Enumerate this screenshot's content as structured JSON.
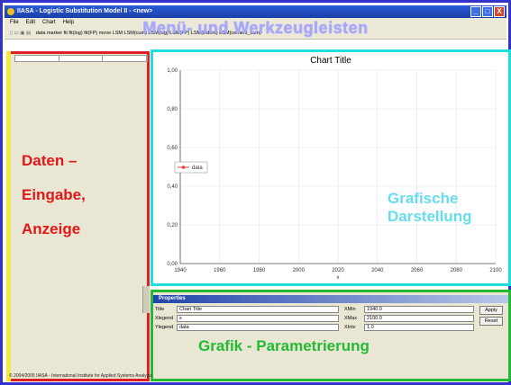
{
  "window": {
    "title": "IIASA - Logistic Substitution Model II - <new>",
    "buttons": [
      "_",
      "□",
      "X"
    ]
  },
  "menu": {
    "items": [
      "File",
      "Edit",
      "Chart",
      "Help"
    ]
  },
  "toolbar": {
    "text": "data marker  fit fit(log)  fit(FP)  move  LSM  LSM(cum)  LSM(log)  LSM(FP)  LSM(indent)  LSM(cement_cum)"
  },
  "overlays": {
    "menu": "Menü- und Werkzeugleisten",
    "data_line1": "Daten –",
    "data_line2": "Eingabe,",
    "data_line3": "Anzeige",
    "chart": "Grafische Darstellung",
    "props": "Grafik - Parametrierung"
  },
  "chart_data": {
    "type": "line",
    "title": "Chart Title",
    "xlabel": "x",
    "ylabel": "",
    "xlim": [
      1940,
      2100
    ],
    "ylim": [
      0.0,
      1.0
    ],
    "x_ticks": [
      "1940",
      "1960",
      "1980",
      "2000",
      "2020",
      "2040",
      "2060",
      "2080",
      "2100"
    ],
    "y_ticks": [
      "0,00",
      "0,20",
      "0,40",
      "0,60",
      "0,80",
      "1,00"
    ],
    "grid": true,
    "legend_placement": "left",
    "series": [
      {
        "name": "data",
        "values": []
      }
    ],
    "series_color": "#e04040"
  },
  "properties": {
    "header": "Properties",
    "rows": [
      {
        "label": "Title",
        "value": "Chart Title"
      },
      {
        "label": "Xlegend",
        "value": "x"
      },
      {
        "label": "Ylegend",
        "value": "data"
      }
    ],
    "x_rows": [
      {
        "label": "XMin",
        "value": "1940.0"
      },
      {
        "label": "XMax",
        "value": "2100.0"
      },
      {
        "label": "XIntv",
        "value": "1.0"
      }
    ],
    "apply_label": "Apply",
    "reset_label": "Reset"
  },
  "status": {
    "text": "© 2004/2005 IIASA - International Institute for Applied Systems Analysis"
  },
  "colors": {
    "menu_frame": "#3333cc",
    "data_frame": "#e02020",
    "chart_frame": "#22dddd",
    "props_frame": "#22bb33"
  }
}
